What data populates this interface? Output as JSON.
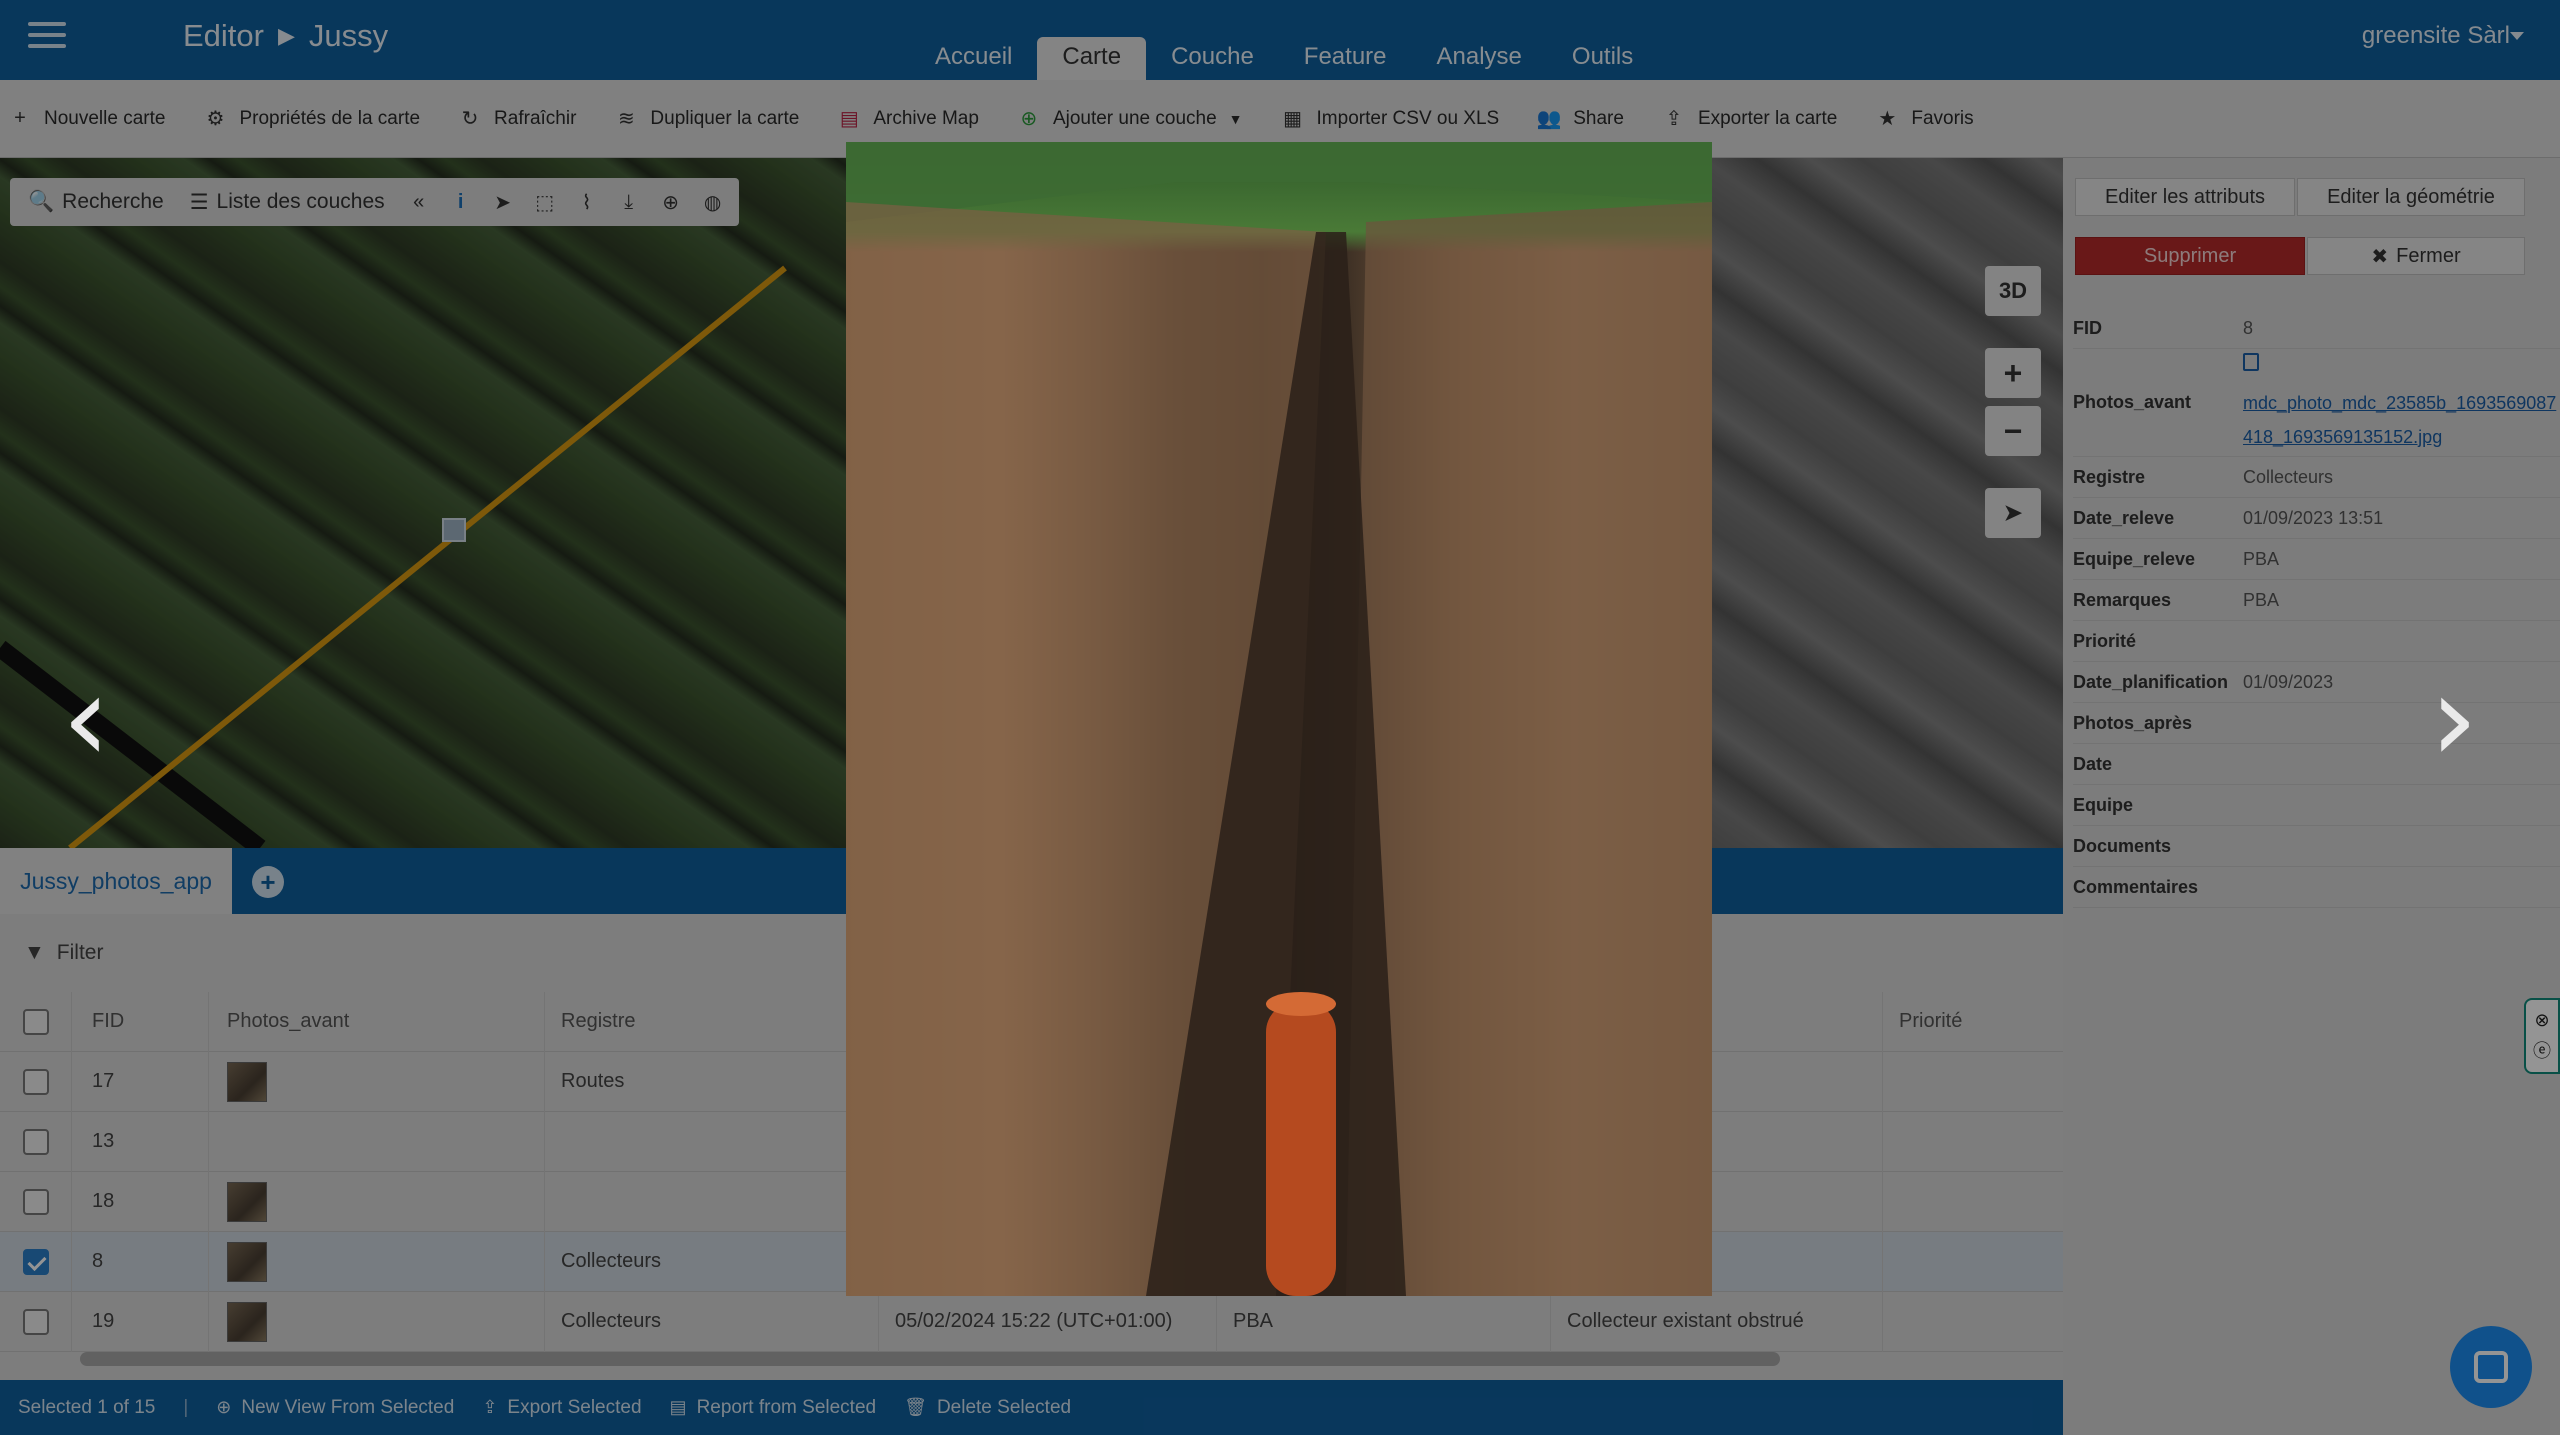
{
  "header": {
    "breadcrumb": [
      "Editor",
      "Jussy"
    ],
    "tabs": [
      "Accueil",
      "Carte",
      "Couche",
      "Feature",
      "Analyse",
      "Outils"
    ],
    "active_tab": "Carte",
    "user": "greensite Sàrl"
  },
  "toolbar": {
    "items": [
      {
        "label": "Nouvelle carte",
        "icon": "plus-icon"
      },
      {
        "label": "Propriétés de la carte",
        "icon": "gear-icon"
      },
      {
        "label": "Rafraîchir",
        "icon": "refresh-icon"
      },
      {
        "label": "Dupliquer la carte",
        "icon": "layers-icon"
      },
      {
        "label": "Archive Map",
        "icon": "archive-icon"
      },
      {
        "label": "Ajouter une couche",
        "icon": "add-circle-icon"
      },
      {
        "label": "Importer CSV ou XLS",
        "icon": "table-icon"
      },
      {
        "label": "Share",
        "icon": "users-icon"
      },
      {
        "label": "Exporter la carte",
        "icon": "export-icon"
      },
      {
        "label": "Favoris",
        "icon": "star-icon"
      }
    ]
  },
  "map": {
    "search_label": "Recherche",
    "layers_label": "Liste des couches",
    "controls": {
      "three_d": "3D",
      "zoom_in": "+",
      "zoom_out": "−"
    }
  },
  "layer_tab": {
    "name": "Jussy_photos_app"
  },
  "table": {
    "filter_label": "Filter",
    "columns": [
      "FID",
      "Photos_avant",
      "Registre",
      "",
      "",
      "",
      "Priorité"
    ],
    "rows": [
      {
        "fid": "17",
        "photo": true,
        "registre": "Routes",
        "c3": "",
        "c4": "",
        "c5": "",
        "selected": false
      },
      {
        "fid": "13",
        "photo": false,
        "registre": "",
        "c3": "",
        "c4": "",
        "c5": "",
        "selected": false
      },
      {
        "fid": "18",
        "photo": true,
        "registre": "",
        "c3": "",
        "c4": "",
        "c5": "",
        "selected": false
      },
      {
        "fid": "8",
        "photo": true,
        "registre": "Collecteurs",
        "c3": "",
        "c4": "",
        "c5": "",
        "selected": true
      },
      {
        "fid": "19",
        "photo": true,
        "registre": "Collecteurs",
        "c3": "05/02/2024 15:22 (UTC+01:00)",
        "c4": "PBA",
        "c5": "Collecteur existant obstrué",
        "selected": false
      }
    ]
  },
  "statusbar": {
    "selected": "Selected 1 of 15",
    "actions": [
      "New View From Selected",
      "Export Selected",
      "Report from Selected",
      "Delete Selected"
    ]
  },
  "panel": {
    "edit_attributes": "Editer les attributs",
    "edit_geometry": "Editer la géométrie",
    "delete": "Supprimer",
    "close": "Fermer",
    "attributes": [
      {
        "key": "FID",
        "value": "8"
      },
      {
        "key": "Photos_avant",
        "value": "mdc_photo_mdc_23585b_1693569087418_1693569135152.jpg",
        "link": true
      },
      {
        "key": "Registre",
        "value": "Collecteurs"
      },
      {
        "key": "Date_releve",
        "value": "01/09/2023 13:51"
      },
      {
        "key": "Equipe_releve",
        "value": "PBA"
      },
      {
        "key": "Remarques",
        "value": "PBA"
      },
      {
        "key": "Priorité",
        "value": ""
      },
      {
        "key": "Date_planification",
        "value": "01/09/2023"
      },
      {
        "key": "Photos_après",
        "value": ""
      },
      {
        "key": "Date",
        "value": ""
      },
      {
        "key": "Equipe",
        "value": ""
      },
      {
        "key": "Documents",
        "value": ""
      },
      {
        "key": "Commentaires",
        "value": ""
      }
    ]
  },
  "colors": {
    "brand": "#0f5f9e",
    "danger": "#b52a2a",
    "link": "#1b5ea6"
  }
}
